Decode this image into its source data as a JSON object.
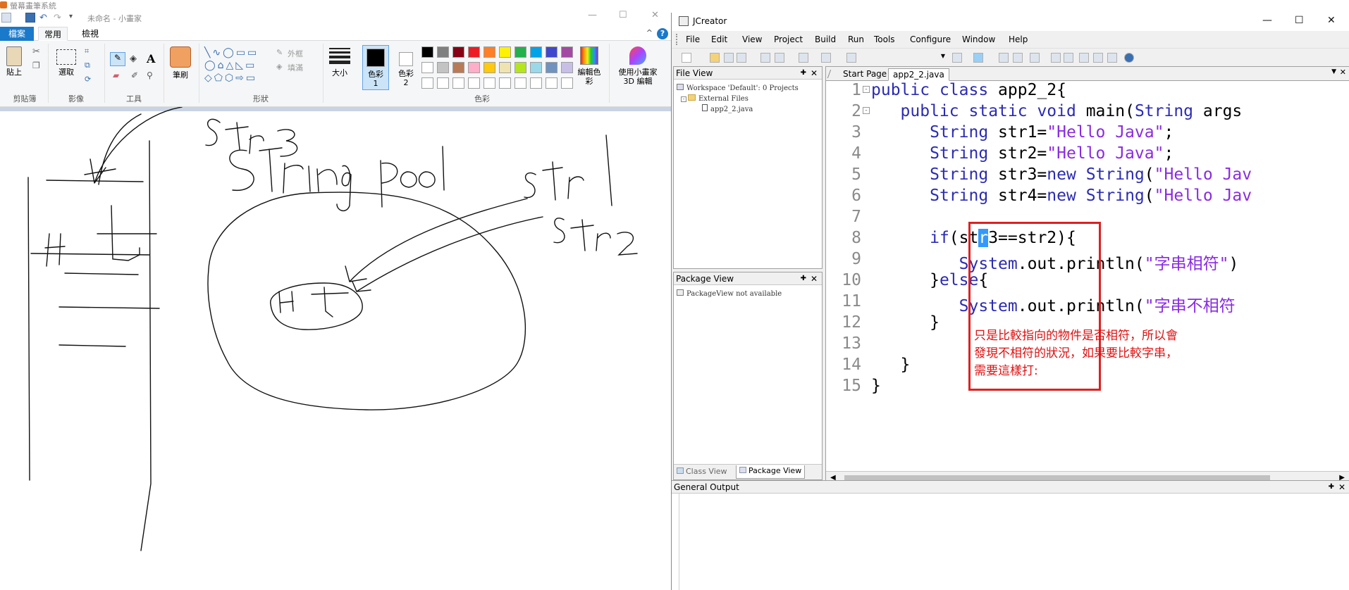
{
  "paint": {
    "app_title": "小畫家",
    "document_title": "未命名 - 小畫家",
    "title_fragment": "螢幕畫筆系統",
    "tabs": [
      "檔案",
      "常用",
      "檢視"
    ],
    "groups": {
      "clipboard": "剪貼簿",
      "image": "影像",
      "tools": "工具",
      "shapes": "形狀",
      "colors": "色彩"
    },
    "buttons": {
      "paste": "貼上",
      "select": "選取",
      "brush": "筆刷",
      "size": "大小",
      "color1": "色彩 1",
      "color2": "色彩 2",
      "edit_colors": "編輯色彩",
      "paint3d": "使用小畫家 3D 編輯",
      "outline": "外框",
      "fill": "填滿"
    },
    "palette_row1": [
      "#000000",
      "#7f7f7f",
      "#880015",
      "#ed1c24",
      "#ff7f27",
      "#fff200",
      "#22b14c",
      "#00a2e8",
      "#3f48cc",
      "#a349a4"
    ],
    "palette_row2": [
      "#ffffff",
      "#c3c3c3",
      "#b97a57",
      "#ffaec9",
      "#ffc90e",
      "#efe4b0",
      "#b5e61d",
      "#99d9ea",
      "#7092be",
      "#c8bfe7"
    ],
    "drawing_labels": [
      "Str3",
      "String pool",
      "str1",
      "Str2",
      "H J",
      "H J"
    ]
  },
  "jcreator": {
    "title": "JCreator",
    "menu": [
      "File",
      "Edit",
      "View",
      "Project",
      "Build",
      "Run",
      "Tools",
      "Configure",
      "Window",
      "Help"
    ],
    "file_view": {
      "title": "File View",
      "workspace": "Workspace 'Default': 0 Projects",
      "external": "External Files",
      "file": "app2_2.java"
    },
    "package_view": {
      "title": "Package View",
      "empty": "PackageView not available"
    },
    "bottom_tabs": [
      "Class View",
      "Package View"
    ],
    "editor_tabs": [
      "Start Page",
      "app2_2.java"
    ],
    "line_numbers": [
      "1",
      "2",
      "3",
      "4",
      "5",
      "6",
      "7",
      "8",
      "9",
      "10",
      "11",
      "12",
      "13",
      "14",
      "15"
    ],
    "annotation": [
      "只是比較指向的物件是否相符，所以會",
      "發現不相符的狀況，如果要比較字串，",
      "需要這樣打:"
    ],
    "output_title": "General Output"
  }
}
